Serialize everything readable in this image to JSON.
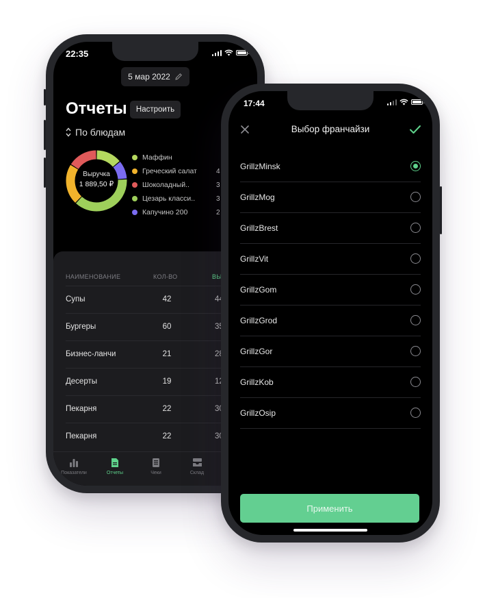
{
  "phone_reports": {
    "status_time": "22:35",
    "date": "5 мар 2022",
    "title": "Отчеты",
    "configure_label": "Настроить",
    "sort_label": "По блюдам",
    "donut_center_label": "Выручка",
    "donut_center_value": "1 889,50 ₽",
    "legend": [
      {
        "name": "Маффин",
        "color": "#b5d85f",
        "value": ""
      },
      {
        "name": "Греческий салат",
        "color": "#f1b32c",
        "value": "4"
      },
      {
        "name": "Шоколадный..",
        "color": "#e05a5a",
        "value": "3"
      },
      {
        "name": "Цезарь класси..",
        "color": "#9ecf5b",
        "value": "3"
      },
      {
        "name": "Капучино 200",
        "color": "#7b6cf0",
        "value": "2"
      }
    ],
    "chart_data": {
      "type": "pie",
      "categories": [
        "Маффин",
        "Греческий салат",
        "Шоколадный..",
        "Цезарь класси..",
        "Капучино 200"
      ],
      "values": [
        14,
        22,
        16,
        38,
        10
      ]
    },
    "table": {
      "headers": [
        "НАИМЕНОВАНИЕ",
        "КОЛ-ВО",
        "ВЫ"
      ],
      "rows": [
        {
          "name": "Супы",
          "qty": "42",
          "rev": "44"
        },
        {
          "name": "Бургеры",
          "qty": "60",
          "rev": "35"
        },
        {
          "name": "Бизнес-ланчи",
          "qty": "21",
          "rev": "28"
        },
        {
          "name": "Десерты",
          "qty": "19",
          "rev": "12"
        },
        {
          "name": "Пекарня",
          "qty": "22",
          "rev": "30"
        },
        {
          "name": "Пекарня",
          "qty": "22",
          "rev": "30"
        }
      ]
    },
    "tabs": [
      {
        "label": "Показатели",
        "icon": "bar-chart-icon"
      },
      {
        "label": "Отчеты",
        "icon": "document-icon",
        "active": true
      },
      {
        "label": "Чеки",
        "icon": "receipt-icon"
      },
      {
        "label": "Склад",
        "icon": "inbox-icon"
      }
    ]
  },
  "phone_franchise": {
    "status_time": "17:44",
    "title": "Выбор франчайзи",
    "items": [
      {
        "name": "GrillzMinsk",
        "selected": true
      },
      {
        "name": "GrillzMog",
        "selected": false
      },
      {
        "name": "GrillzBrest",
        "selected": false
      },
      {
        "name": "GrillzVit",
        "selected": false
      },
      {
        "name": "GrillzGom",
        "selected": false
      },
      {
        "name": "GrillzGrod",
        "selected": false
      },
      {
        "name": "GrillzGor",
        "selected": false
      },
      {
        "name": "GrillzKob",
        "selected": false
      },
      {
        "name": "GrillzOsip",
        "selected": false
      }
    ],
    "apply_label": "Применить"
  },
  "colors": {
    "accent": "#5fd38c",
    "background": "#000000",
    "card": "#1c1c1f"
  }
}
